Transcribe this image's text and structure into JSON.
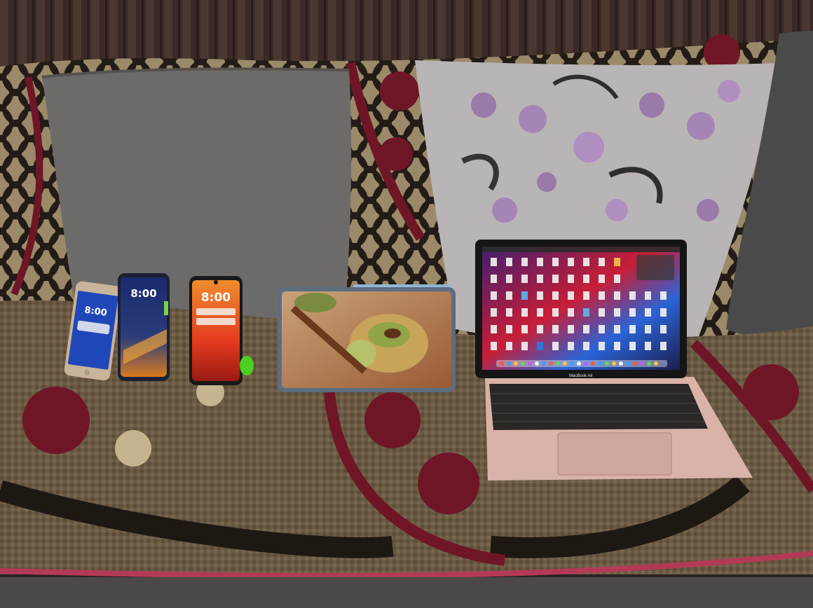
{
  "phones": [
    {
      "name": "phone-left",
      "time": "8:00"
    },
    {
      "name": "phone-middle",
      "time": "8:00"
    },
    {
      "name": "phone-right",
      "time": "8:00"
    }
  ],
  "laptop": {
    "brand_label": "MacBook Air"
  },
  "colors": {
    "wall": "#3b2a26",
    "sofa_fabric": "#5b4a36",
    "maroon_pattern": "#6f1626",
    "grey_pillow": "#6d6b6a",
    "floral_pillow": "#b9b4b6",
    "laptop_body": "#d9b3a7"
  }
}
